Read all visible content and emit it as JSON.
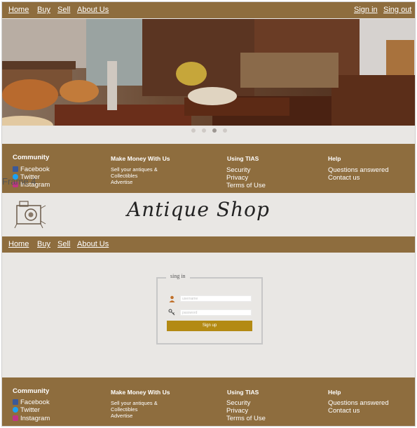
{
  "nav": {
    "home": "Home",
    "buy": "Buy",
    "sell": "Sell",
    "about": "About Us",
    "signin": "Sign in",
    "signout": "Sing out"
  },
  "carousel": {
    "slide_count": 4,
    "active_slide": 3
  },
  "footer": {
    "community_title": "Community",
    "facebook": "Facebook",
    "twitter": "Twitter",
    "instagram": "Instagram",
    "money_title": "Make Money With Us",
    "money_item_1": "Sell your antiques &",
    "money_item_2": "Collectibles",
    "money_item_3": "Advertise",
    "using_title": "Using TIAS",
    "security": "Security",
    "privacy": "Privacy",
    "terms": "Terms of Use",
    "help_title": "Help",
    "questions": "Questions answered",
    "contact": "Contact us"
  },
  "overlay_text": "Frame 4",
  "brand": {
    "title": "Antique Shop"
  },
  "login": {
    "legend": "sing in",
    "username_placeholder": "username",
    "password_placeholder": "password",
    "button": "Sign up"
  },
  "colors": {
    "brand_brown": "#8e6d3e",
    "button_gold": "#b38a14",
    "background": "#e9e7e4"
  }
}
